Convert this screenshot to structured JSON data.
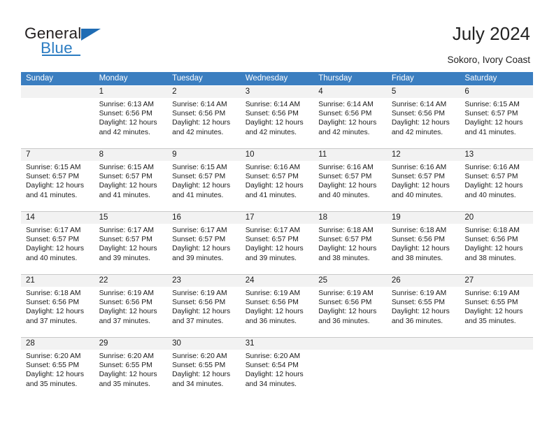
{
  "brand": {
    "name_top": "General",
    "name_bottom": "Blue",
    "accent_color": "#2b7cc2",
    "triangle_color": "#1f6cb4"
  },
  "header": {
    "title": "July 2024",
    "subtitle": "Sokoro, Ivory Coast"
  },
  "theme": {
    "header_row_bg": "#3b7ec0",
    "header_row_text": "#ffffff",
    "daynum_band_bg": "#f2f2f2",
    "cell_bg": "#ffffff",
    "week_separator": "#c8c8c8",
    "text": "#1a1a1a"
  },
  "calendar": {
    "weekday_headers": [
      "Sunday",
      "Monday",
      "Tuesday",
      "Wednesday",
      "Thursday",
      "Friday",
      "Saturday"
    ],
    "weeks": [
      [
        {
          "day": "",
          "sunrise": "",
          "sunset": "",
          "daylight_line1": "",
          "daylight_line2": "",
          "blank": true
        },
        {
          "day": "1",
          "sunrise": "Sunrise: 6:13 AM",
          "sunset": "Sunset: 6:56 PM",
          "daylight_line1": "Daylight: 12 hours",
          "daylight_line2": "and 42 minutes."
        },
        {
          "day": "2",
          "sunrise": "Sunrise: 6:14 AM",
          "sunset": "Sunset: 6:56 PM",
          "daylight_line1": "Daylight: 12 hours",
          "daylight_line2": "and 42 minutes."
        },
        {
          "day": "3",
          "sunrise": "Sunrise: 6:14 AM",
          "sunset": "Sunset: 6:56 PM",
          "daylight_line1": "Daylight: 12 hours",
          "daylight_line2": "and 42 minutes."
        },
        {
          "day": "4",
          "sunrise": "Sunrise: 6:14 AM",
          "sunset": "Sunset: 6:56 PM",
          "daylight_line1": "Daylight: 12 hours",
          "daylight_line2": "and 42 minutes."
        },
        {
          "day": "5",
          "sunrise": "Sunrise: 6:14 AM",
          "sunset": "Sunset: 6:56 PM",
          "daylight_line1": "Daylight: 12 hours",
          "daylight_line2": "and 42 minutes."
        },
        {
          "day": "6",
          "sunrise": "Sunrise: 6:15 AM",
          "sunset": "Sunset: 6:57 PM",
          "daylight_line1": "Daylight: 12 hours",
          "daylight_line2": "and 41 minutes."
        }
      ],
      [
        {
          "day": "7",
          "sunrise": "Sunrise: 6:15 AM",
          "sunset": "Sunset: 6:57 PM",
          "daylight_line1": "Daylight: 12 hours",
          "daylight_line2": "and 41 minutes."
        },
        {
          "day": "8",
          "sunrise": "Sunrise: 6:15 AM",
          "sunset": "Sunset: 6:57 PM",
          "daylight_line1": "Daylight: 12 hours",
          "daylight_line2": "and 41 minutes."
        },
        {
          "day": "9",
          "sunrise": "Sunrise: 6:15 AM",
          "sunset": "Sunset: 6:57 PM",
          "daylight_line1": "Daylight: 12 hours",
          "daylight_line2": "and 41 minutes."
        },
        {
          "day": "10",
          "sunrise": "Sunrise: 6:16 AM",
          "sunset": "Sunset: 6:57 PM",
          "daylight_line1": "Daylight: 12 hours",
          "daylight_line2": "and 41 minutes."
        },
        {
          "day": "11",
          "sunrise": "Sunrise: 6:16 AM",
          "sunset": "Sunset: 6:57 PM",
          "daylight_line1": "Daylight: 12 hours",
          "daylight_line2": "and 40 minutes."
        },
        {
          "day": "12",
          "sunrise": "Sunrise: 6:16 AM",
          "sunset": "Sunset: 6:57 PM",
          "daylight_line1": "Daylight: 12 hours",
          "daylight_line2": "and 40 minutes."
        },
        {
          "day": "13",
          "sunrise": "Sunrise: 6:16 AM",
          "sunset": "Sunset: 6:57 PM",
          "daylight_line1": "Daylight: 12 hours",
          "daylight_line2": "and 40 minutes."
        }
      ],
      [
        {
          "day": "14",
          "sunrise": "Sunrise: 6:17 AM",
          "sunset": "Sunset: 6:57 PM",
          "daylight_line1": "Daylight: 12 hours",
          "daylight_line2": "and 40 minutes."
        },
        {
          "day": "15",
          "sunrise": "Sunrise: 6:17 AM",
          "sunset": "Sunset: 6:57 PM",
          "daylight_line1": "Daylight: 12 hours",
          "daylight_line2": "and 39 minutes."
        },
        {
          "day": "16",
          "sunrise": "Sunrise: 6:17 AM",
          "sunset": "Sunset: 6:57 PM",
          "daylight_line1": "Daylight: 12 hours",
          "daylight_line2": "and 39 minutes."
        },
        {
          "day": "17",
          "sunrise": "Sunrise: 6:17 AM",
          "sunset": "Sunset: 6:57 PM",
          "daylight_line1": "Daylight: 12 hours",
          "daylight_line2": "and 39 minutes."
        },
        {
          "day": "18",
          "sunrise": "Sunrise: 6:18 AM",
          "sunset": "Sunset: 6:57 PM",
          "daylight_line1": "Daylight: 12 hours",
          "daylight_line2": "and 38 minutes."
        },
        {
          "day": "19",
          "sunrise": "Sunrise: 6:18 AM",
          "sunset": "Sunset: 6:56 PM",
          "daylight_line1": "Daylight: 12 hours",
          "daylight_line2": "and 38 minutes."
        },
        {
          "day": "20",
          "sunrise": "Sunrise: 6:18 AM",
          "sunset": "Sunset: 6:56 PM",
          "daylight_line1": "Daylight: 12 hours",
          "daylight_line2": "and 38 minutes."
        }
      ],
      [
        {
          "day": "21",
          "sunrise": "Sunrise: 6:18 AM",
          "sunset": "Sunset: 6:56 PM",
          "daylight_line1": "Daylight: 12 hours",
          "daylight_line2": "and 37 minutes."
        },
        {
          "day": "22",
          "sunrise": "Sunrise: 6:19 AM",
          "sunset": "Sunset: 6:56 PM",
          "daylight_line1": "Daylight: 12 hours",
          "daylight_line2": "and 37 minutes."
        },
        {
          "day": "23",
          "sunrise": "Sunrise: 6:19 AM",
          "sunset": "Sunset: 6:56 PM",
          "daylight_line1": "Daylight: 12 hours",
          "daylight_line2": "and 37 minutes."
        },
        {
          "day": "24",
          "sunrise": "Sunrise: 6:19 AM",
          "sunset": "Sunset: 6:56 PM",
          "daylight_line1": "Daylight: 12 hours",
          "daylight_line2": "and 36 minutes."
        },
        {
          "day": "25",
          "sunrise": "Sunrise: 6:19 AM",
          "sunset": "Sunset: 6:56 PM",
          "daylight_line1": "Daylight: 12 hours",
          "daylight_line2": "and 36 minutes."
        },
        {
          "day": "26",
          "sunrise": "Sunrise: 6:19 AM",
          "sunset": "Sunset: 6:55 PM",
          "daylight_line1": "Daylight: 12 hours",
          "daylight_line2": "and 36 minutes."
        },
        {
          "day": "27",
          "sunrise": "Sunrise: 6:19 AM",
          "sunset": "Sunset: 6:55 PM",
          "daylight_line1": "Daylight: 12 hours",
          "daylight_line2": "and 35 minutes."
        }
      ],
      [
        {
          "day": "28",
          "sunrise": "Sunrise: 6:20 AM",
          "sunset": "Sunset: 6:55 PM",
          "daylight_line1": "Daylight: 12 hours",
          "daylight_line2": "and 35 minutes."
        },
        {
          "day": "29",
          "sunrise": "Sunrise: 6:20 AM",
          "sunset": "Sunset: 6:55 PM",
          "daylight_line1": "Daylight: 12 hours",
          "daylight_line2": "and 35 minutes."
        },
        {
          "day": "30",
          "sunrise": "Sunrise: 6:20 AM",
          "sunset": "Sunset: 6:55 PM",
          "daylight_line1": "Daylight: 12 hours",
          "daylight_line2": "and 34 minutes."
        },
        {
          "day": "31",
          "sunrise": "Sunrise: 6:20 AM",
          "sunset": "Sunset: 6:54 PM",
          "daylight_line1": "Daylight: 12 hours",
          "daylight_line2": "and 34 minutes."
        },
        {
          "day": "",
          "sunrise": "",
          "sunset": "",
          "daylight_line1": "",
          "daylight_line2": "",
          "blank": true
        },
        {
          "day": "",
          "sunrise": "",
          "sunset": "",
          "daylight_line1": "",
          "daylight_line2": "",
          "blank": true
        },
        {
          "day": "",
          "sunrise": "",
          "sunset": "",
          "daylight_line1": "",
          "daylight_line2": "",
          "blank": true
        }
      ]
    ]
  }
}
